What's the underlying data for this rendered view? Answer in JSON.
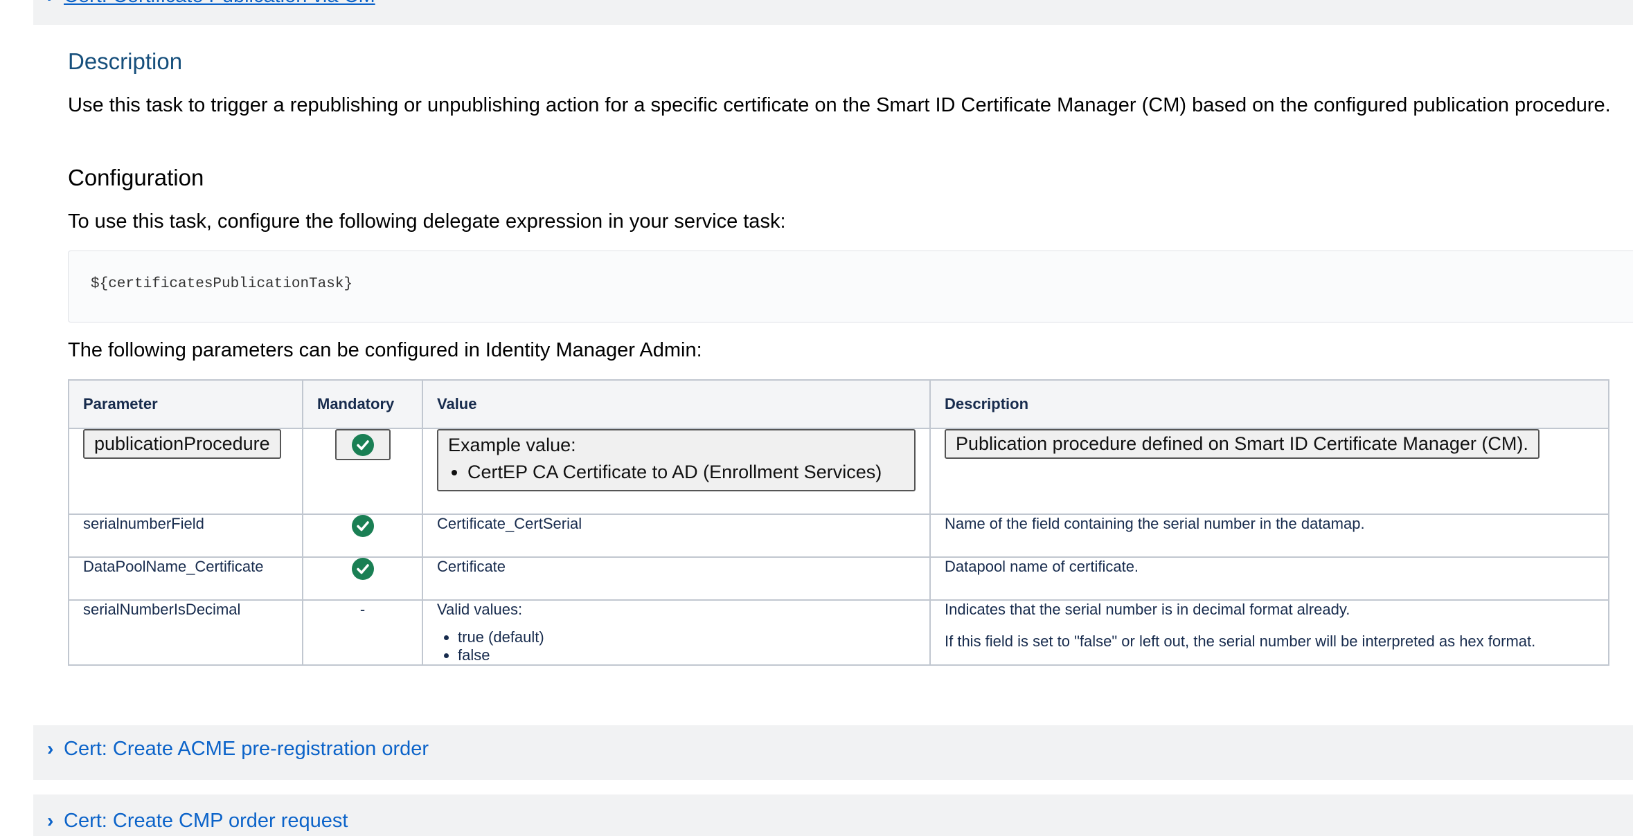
{
  "sections": {
    "top": {
      "title": "Cert: Certificate Publication via CM"
    },
    "acme": {
      "title": "Cert: Create ACME pre-registration order"
    },
    "cmp": {
      "title": "Cert: Create CMP order request"
    }
  },
  "description": {
    "heading": "Description",
    "text": "Use this task to trigger a republishing or unpublishing action for a specific certificate on the Smart ID Certificate Manager (CM) based on the configured publication procedure."
  },
  "configuration": {
    "heading": "Configuration",
    "text": "To use this task, configure the following delegate expression in your service task:",
    "code": "${certificatesPublicationTask}",
    "params_intro": "The following parameters can be configured in Identity Manager Admin:"
  },
  "table": {
    "headers": [
      "Parameter",
      "Mandatory",
      "Value",
      "Description"
    ],
    "rows": [
      {
        "parameter": "publicationProcedure",
        "mandatory": "check",
        "value_label": "Example value:",
        "value_items": [
          "CertEP CA Certificate to AD (Enrollment Services)"
        ],
        "description": "Publication procedure defined on Smart ID Certificate Manager (CM)."
      },
      {
        "parameter": "serialnumberField",
        "mandatory": "check",
        "value": "Certificate_CertSerial",
        "description": "Name of the field containing the serial number in the datamap."
      },
      {
        "parameter": "DataPoolName_Certificate",
        "mandatory": "check",
        "value": "Certificate",
        "description": "Datapool name of certificate."
      },
      {
        "parameter": "serialNumberIsDecimal",
        "mandatory": "-",
        "value_label": "Valid values:",
        "value_items": [
          "true (default)",
          "false"
        ],
        "description": "Indicates that the serial number is in decimal format already.",
        "description_2": "If this field is set to \"false\" or left out, the serial number will be interpreted as hex format."
      }
    ]
  },
  "icons": {
    "chevron": "chevron-right-icon",
    "mandatory": "check-circle-icon"
  },
  "colors": {
    "link": "#0b63c9",
    "check": "#1a7f54",
    "heading": "#164f7c",
    "bar": "#f1f2f3"
  }
}
